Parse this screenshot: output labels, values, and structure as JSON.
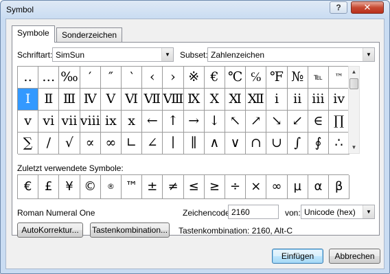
{
  "window": {
    "title": "Symbol",
    "help_label": "?",
    "close_label": "✕"
  },
  "tabs": [
    {
      "label": "Symbole"
    },
    {
      "label": "Sonderzeichen"
    }
  ],
  "font": {
    "label": "Schriftart:",
    "value": "SimSun"
  },
  "subset": {
    "label": "Subset:",
    "value": "Zahlenzeichen"
  },
  "symbol_grid": [
    [
      "‥",
      "…",
      "‰",
      "′",
      "″",
      "‵",
      "‹",
      "›",
      "※",
      "€",
      "℃",
      "℅",
      "℉",
      "№",
      "℡",
      "™"
    ],
    [
      "Ⅰ",
      "Ⅱ",
      "Ⅲ",
      "Ⅳ",
      "Ⅴ",
      "Ⅵ",
      "Ⅶ",
      "Ⅷ",
      "Ⅸ",
      "Ⅹ",
      "Ⅺ",
      "Ⅻ",
      "ⅰ",
      "ⅱ",
      "ⅲ",
      "ⅳ"
    ],
    [
      "ⅴ",
      "ⅵ",
      "ⅶ",
      "ⅷ",
      "ⅸ",
      "ⅹ",
      "←",
      "↑",
      "→",
      "↓",
      "↖",
      "↗",
      "↘",
      "↙",
      "∈",
      "∏"
    ],
    [
      "∑",
      "∕",
      "√",
      "∝",
      "∞",
      "∟",
      "∠",
      "∣",
      "∥",
      "∧",
      "∨",
      "∩",
      "∪",
      "∫",
      "∮",
      "∴"
    ]
  ],
  "selected_symbol": "Ⅰ",
  "recent": {
    "label": "Zuletzt verwendete Symbole:",
    "symbols": [
      "€",
      "£",
      "¥",
      "©",
      "®",
      "™",
      "±",
      "≠",
      "≤",
      "≥",
      "÷",
      "×",
      "∞",
      "µ",
      "α",
      "β"
    ]
  },
  "symbol_name": "Roman Numeral One",
  "char_code": {
    "label": "Zeichencode:",
    "value": "2160"
  },
  "from": {
    "label": "von:",
    "value": "Unicode (hex)"
  },
  "buttons": {
    "autocorrect": "AutoKorrektur...",
    "shortcut_key": "Tastenkombination...",
    "insert": "Einfügen",
    "cancel": "Abbrechen"
  },
  "shortcut_text": "Tastenkombination: 2160, Alt-C"
}
